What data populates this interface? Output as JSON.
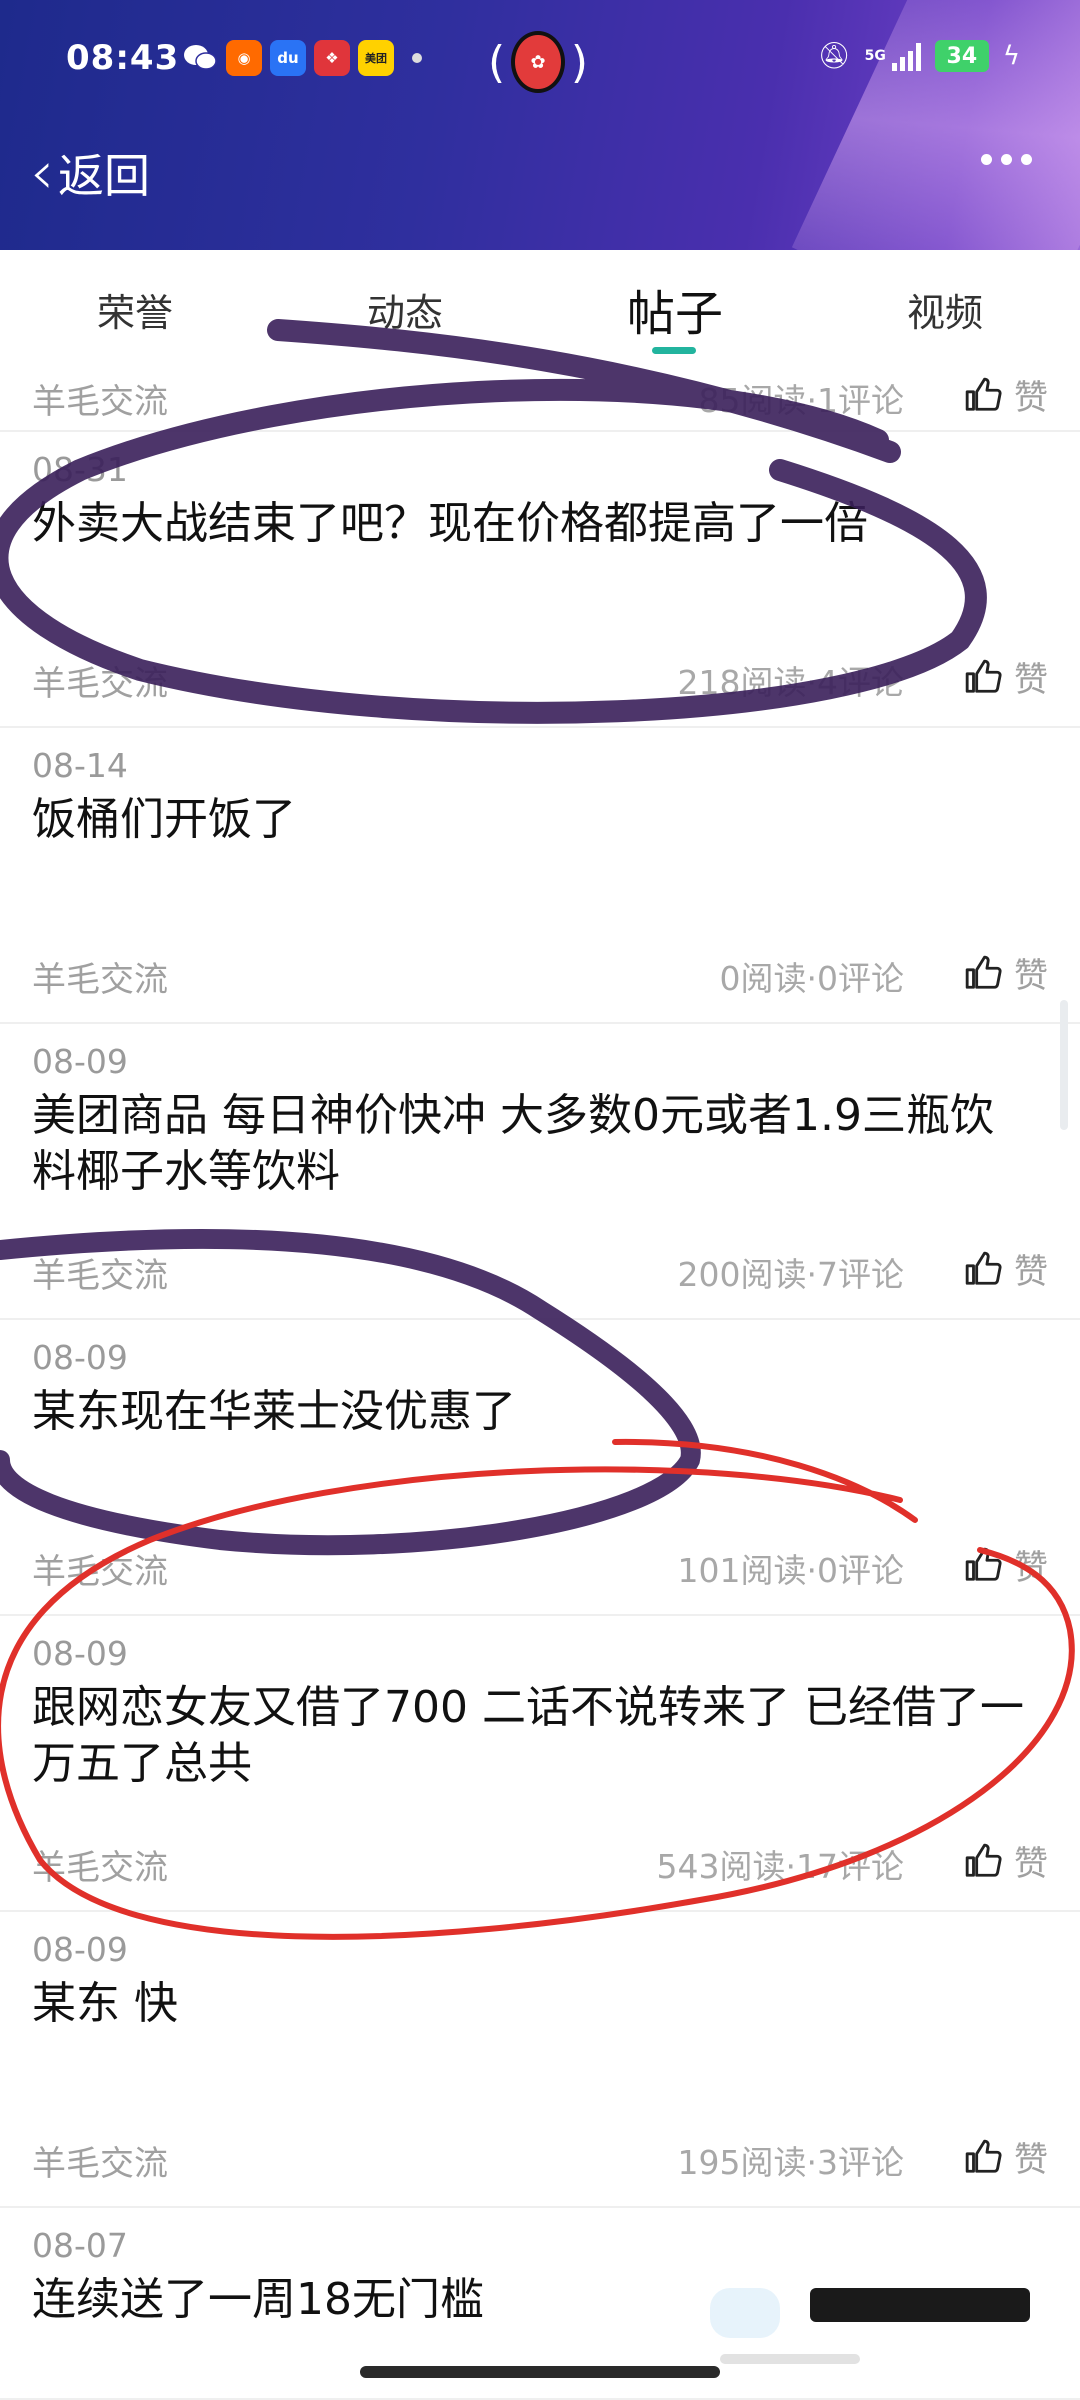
{
  "status_bar": {
    "time": "08:43",
    "app_icons": [
      "wechat-icon",
      "taobao-icon",
      "baidu-icon",
      "pinduoduo-icon",
      "meituan-icon"
    ],
    "meituan_label": "美团",
    "network": "5G",
    "battery": "34"
  },
  "nav": {
    "back_label": "返回"
  },
  "tabs": [
    {
      "label": "荣誉"
    },
    {
      "label": "动态"
    },
    {
      "label": "帖子",
      "active": true
    },
    {
      "label": "视频"
    }
  ],
  "colors": {
    "accent": "#22b49e",
    "header_start": "#1e2a8c",
    "header_end": "#9a6ad8",
    "scribble_purple": "#3a1f5a",
    "scribble_red": "#e0302a"
  },
  "partial_post": {
    "category": "羊毛交流",
    "stats": "85阅读·1评论",
    "like_label": "赞"
  },
  "posts": [
    {
      "date": "08-31",
      "title": "外卖大战结束了吧？现在价格都提高了一倍",
      "category": "羊毛交流",
      "stats": "218阅读·4评论",
      "like_label": "赞"
    },
    {
      "date": "08-14",
      "title": "饭桶们开饭了",
      "category": "羊毛交流",
      "stats": "0阅读·0评论",
      "like_label": "赞"
    },
    {
      "date": "08-09",
      "title": "美团商品 每日神价快冲 大多数0元或者1.9三瓶饮料椰子水等饮料",
      "category": "羊毛交流",
      "stats": "200阅读·7评论",
      "like_label": "赞"
    },
    {
      "date": "08-09",
      "title": "某东现在华莱士没优惠了",
      "category": "羊毛交流",
      "stats": "101阅读·0评论",
      "like_label": "赞"
    },
    {
      "date": "08-09",
      "title": "跟网恋女友又借了700 二话不说转来了 已经借了一万五了总共",
      "category": "羊毛交流",
      "stats": "543阅读·17评论",
      "like_label": "赞"
    },
    {
      "date": "08-09",
      "title": "某东 快",
      "category": "羊毛交流",
      "stats": "195阅读·3评论",
      "like_label": "赞"
    },
    {
      "date": "08-07",
      "title": "连续送了一周18无门槛"
    }
  ]
}
